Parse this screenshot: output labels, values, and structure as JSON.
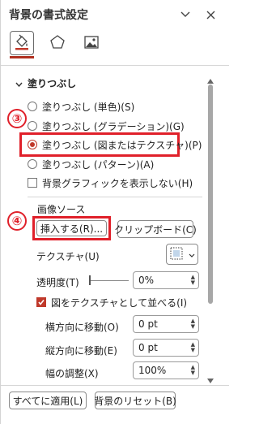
{
  "header": {
    "title": "背景の書式設定",
    "collapse_icon": "chevron-down-icon",
    "close_icon": "close-icon"
  },
  "tabs": [
    {
      "name": "fill",
      "icon": "paint-bucket-icon",
      "selected": true
    },
    {
      "name": "effects",
      "icon": "pentagon-icon",
      "selected": false
    },
    {
      "name": "picture",
      "icon": "picture-icon",
      "selected": false
    }
  ],
  "fill_section": {
    "title": "塗りつぶし",
    "options": [
      {
        "label": "塗りつぶし (単色)(S)",
        "selected": false
      },
      {
        "label": "塗りつぶし (グラデーション)(G)",
        "selected": false
      },
      {
        "label": "塗りつぶし (図またはテクスチャ)(P)",
        "selected": true
      },
      {
        "label": "塗りつぶし (パターン)(A)",
        "selected": false
      }
    ],
    "hide_bg_graphics": {
      "label": "背景グラフィックを表示しない(H)",
      "checked": false
    }
  },
  "annotations": {
    "step3": "③",
    "step4": "④"
  },
  "image_source": {
    "heading": "画像ソース",
    "insert_button": "挿入する(R)...",
    "clipboard_button": "クリップボード(C)"
  },
  "texture": {
    "label": "テクスチャ(U)"
  },
  "transparency": {
    "label": "透明度(T)",
    "value": "0%",
    "level": 0
  },
  "tile": {
    "label": "図をテクスチャとして並べる(I)",
    "checked": true
  },
  "offset_x": {
    "label": "横方向に移動(O)",
    "value": "0 pt"
  },
  "offset_y": {
    "label": "縦方向に移動(E)",
    "value": "0 pt"
  },
  "scale_x": {
    "label": "幅の調整(X)",
    "value": "100%"
  },
  "footer": {
    "apply_all_button": "すべてに適用(L)",
    "reset_button": "背景のリセット(B)"
  },
  "colors": {
    "accent": "#c0392b",
    "highlight": "#e0202a"
  }
}
